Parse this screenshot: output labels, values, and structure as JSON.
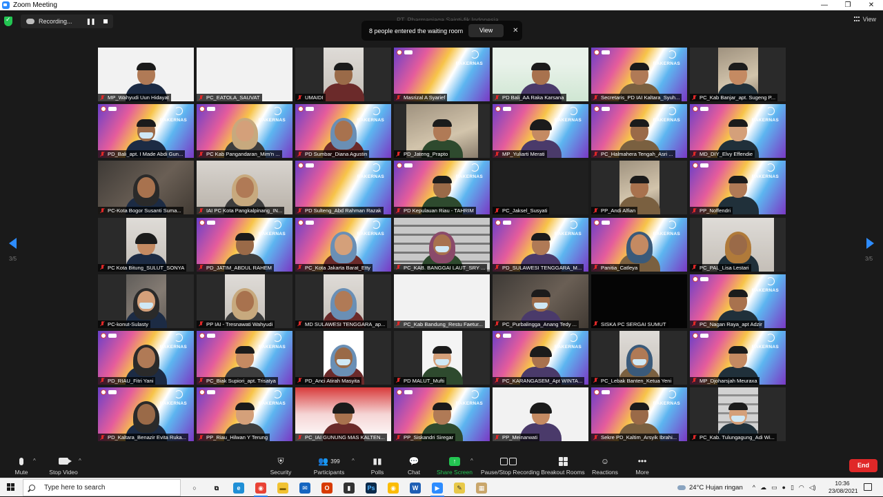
{
  "window": {
    "title": "Zoom Meeting",
    "controls": [
      "—",
      "❐",
      "✕"
    ]
  },
  "recording": {
    "label": "Recording..."
  },
  "meeting_host": "PT. Pharmaniaga Sainti-fik Indonesia",
  "notification": {
    "message": "8 people entered the waiting room",
    "view_label": "View",
    "close_label": "✕"
  },
  "view_label": "View",
  "pager": {
    "left": "3/5",
    "right": "3/5"
  },
  "participants": [
    {
      "name": "MP_Wahyudi Uun Hidayat",
      "bg": "white",
      "person": "man"
    },
    {
      "name": "PC_EATOLA_SAUVAT",
      "bg": "white",
      "person": "none",
      "variant": "slide"
    },
    {
      "name": "UMAIDI",
      "bg": "wall",
      "person": "man",
      "frame": "narrow"
    },
    {
      "name": "Masrizal A Syarief",
      "bg": "rak",
      "person": "none"
    },
    {
      "name": "PD Bali_AA Raka Karsana",
      "bg": "green",
      "person": "man"
    },
    {
      "name": "Secretaris_PD IAI Kaltara_Syuh...",
      "bg": "rak",
      "person": "man"
    },
    {
      "name": "PC_Kab Banjar_apt. Sugeng P...",
      "bg": "indoor",
      "person": "man",
      "frame": "narrow"
    },
    {
      "name": "PD_Bali_apt. I Made Abdi Gun...",
      "bg": "rak",
      "person": "masked"
    },
    {
      "name": "PC Kab Pangandaran_Mim'n ...",
      "bg": "rak",
      "person": "hijab"
    },
    {
      "name": "PD Sumbar_Diana Agustin",
      "bg": "rak",
      "person": "hijab"
    },
    {
      "name": "PD_Jateng_Prapto",
      "bg": "indoor",
      "person": "man",
      "frame": "wide"
    },
    {
      "name": "MP_Yuliarti Merati",
      "bg": "rak",
      "person": "woman"
    },
    {
      "name": "PC_Halmahera Tengah_Asri ...",
      "bg": "rak",
      "person": "man"
    },
    {
      "name": "MD_DIY_Elvy Effendie",
      "bg": "rak",
      "person": "man"
    },
    {
      "name": "PC-Kota Bogor Susanti Suma...",
      "bg": "off",
      "person": "hijab"
    },
    {
      "name": "IAI PC Kota Pangkalpinang_IN...",
      "bg": "wall",
      "person": "hijab"
    },
    {
      "name": "PD Sulteng_Abd Rahman Razak",
      "bg": "rak",
      "person": "none"
    },
    {
      "name": "PD Kepulauan Riau - TAHRIM",
      "bg": "rak",
      "person": "man"
    },
    {
      "name": "PC_Jaksel_Susyati",
      "bg": "dark",
      "person": "none"
    },
    {
      "name": "PP_Andi Alfian",
      "bg": "indoor",
      "person": "man",
      "frame": "narrow"
    },
    {
      "name": "PP_Noffendri",
      "bg": "rak",
      "person": "man"
    },
    {
      "name": "PC Kota Bitung_SULUT_SONYA",
      "bg": "wall",
      "person": "woman",
      "frame": "narrow"
    },
    {
      "name": "PD_JATIM_ABDUL RAHEM",
      "bg": "rak",
      "person": "man"
    },
    {
      "name": "PC_Kota Jakarta Barat_Etty",
      "bg": "rak",
      "person": "hijab"
    },
    {
      "name": "PC_KAB. BANGGAI LAUT_SRY ...",
      "bg": "shelf",
      "person": "masked-hijab"
    },
    {
      "name": "PD_SULAWESI TENGGARA_M...",
      "bg": "rak",
      "person": "man"
    },
    {
      "name": "Panitia_Catleya",
      "bg": "rak",
      "person": "hijab"
    },
    {
      "name": "PC_PAL_Lisa Lestari",
      "bg": "wall",
      "person": "hijab",
      "frame": "wide"
    },
    {
      "name": "PC-konut-Sulasty",
      "bg": "off",
      "person": "masked-hijab",
      "frame": "narrow"
    },
    {
      "name": "PP IAI - Tresnawati Wahyudi",
      "bg": "wall",
      "person": "hijab",
      "frame": "narrow"
    },
    {
      "name": "MD SULAWESI TENGGARA_ap...",
      "bg": "wall",
      "person": "hijab",
      "frame": "narrow"
    },
    {
      "name": "PC_Kab Bandung_Restu Faetur...",
      "bg": "white",
      "person": "none",
      "variant": "blur"
    },
    {
      "name": "PC_Purbalingga_Anang Tedy ...",
      "bg": "off",
      "person": "masked"
    },
    {
      "name": "SISKA PC SERGAI SUMUT",
      "bg": "black",
      "person": "none"
    },
    {
      "name": "PC_Nagan Raya_apt Adzir",
      "bg": "rak",
      "person": "man"
    },
    {
      "name": "PD_RIAU_Fitri Yani",
      "bg": "rak",
      "person": "hijab"
    },
    {
      "name": "PC_Biak Supiori_apt. Trisatya",
      "bg": "rak",
      "person": "man"
    },
    {
      "name": "PD_Anci Atirah Masyita",
      "bg": "dark",
      "person": "masked-hijab",
      "frame": "narrow"
    },
    {
      "name": "PD MALUT_Mufti",
      "bg": "white",
      "person": "masked",
      "frame": "narrow"
    },
    {
      "name": "PC_KARANGASEM_Apt WINTA...",
      "bg": "rak",
      "person": "woman"
    },
    {
      "name": "PC_Lebak Banten_Ketua Yeni",
      "bg": "wall",
      "person": "masked-hijab",
      "frame": "narrow"
    },
    {
      "name": "MP_Djoharsjah Meuraxa",
      "bg": "rak",
      "person": "man"
    },
    {
      "name": "PD_Kaltara_Benazir Evita Ruka...",
      "bg": "rak",
      "person": "hijab"
    },
    {
      "name": "PP_Riau_Hilwan Y Terung",
      "bg": "rak",
      "person": "man"
    },
    {
      "name": "PC_IAI GUNUNG MAS KALTEN...",
      "bg": "red",
      "person": "woman"
    },
    {
      "name": "PP_Siskandri Siregar",
      "bg": "rak",
      "person": "man"
    },
    {
      "name": "PP_Meinarwati",
      "bg": "white",
      "person": "woman"
    },
    {
      "name": "Sekre PD_Kaltim_Arsyik Ibrahi...",
      "bg": "rak",
      "person": "man"
    },
    {
      "name": "PC_Kab. Tulungagung_Adi Wi...",
      "bg": "shelf",
      "person": "masked",
      "frame": "narrow"
    }
  ],
  "tile_texts": {
    "rakernas": "RAKERNAS"
  },
  "toolbar": {
    "mute": "Mute",
    "stop_video": "Stop Video",
    "security": "Security",
    "participants": "Participants",
    "participants_count": "399",
    "polls": "Polls",
    "chat": "Chat",
    "share_screen": "Share Screen",
    "pause_recording": "Pause/Stop Recording",
    "breakout": "Breakout Rooms",
    "reactions": "Reactions",
    "more": "More",
    "end": "End"
  },
  "taskbar": {
    "search_placeholder": "Type here to search",
    "weather": "24°C  Hujan ringan",
    "time": "10:36",
    "date": "23/08/2021",
    "apps": [
      {
        "name": "cortana",
        "glyph": "○",
        "color": "#f3f3f3",
        "text": "#111"
      },
      {
        "name": "task-view",
        "glyph": "⧉",
        "color": "#f3f3f3",
        "text": "#111"
      },
      {
        "name": "edge",
        "glyph": "e",
        "color": "#1f8fd6",
        "text": "#fff"
      },
      {
        "name": "chrome",
        "glyph": "◉",
        "color": "#e94235",
        "text": "#fff"
      },
      {
        "name": "file-explorer",
        "glyph": "▬",
        "color": "#f1c232",
        "text": "#7a5b00"
      },
      {
        "name": "mail",
        "glyph": "✉",
        "color": "#1565c0",
        "text": "#fff"
      },
      {
        "name": "office",
        "glyph": "O",
        "color": "#d83b01",
        "text": "#fff"
      },
      {
        "name": "folder",
        "glyph": "▮",
        "color": "#333",
        "text": "#fff"
      },
      {
        "name": "photoshop",
        "glyph": "Ps",
        "color": "#0b2a4a",
        "text": "#4fb3ff"
      },
      {
        "name": "chrome-2",
        "glyph": "◉",
        "color": "#fbbc04",
        "text": "#fff"
      },
      {
        "name": "word",
        "glyph": "W",
        "color": "#1f5fb4",
        "text": "#fff"
      },
      {
        "name": "zoom",
        "glyph": "▶",
        "color": "#2d8cff",
        "text": "#fff"
      },
      {
        "name": "pen-tool",
        "glyph": "✎",
        "color": "#e8c94a",
        "text": "#333"
      },
      {
        "name": "video-app",
        "glyph": "▦",
        "color": "#c9a66b",
        "text": "#fff"
      }
    ]
  },
  "colors": {
    "accent": "#2d8cff",
    "muted_mic": "#e02828",
    "share_green": "#23c552",
    "end_red": "#e02828"
  }
}
